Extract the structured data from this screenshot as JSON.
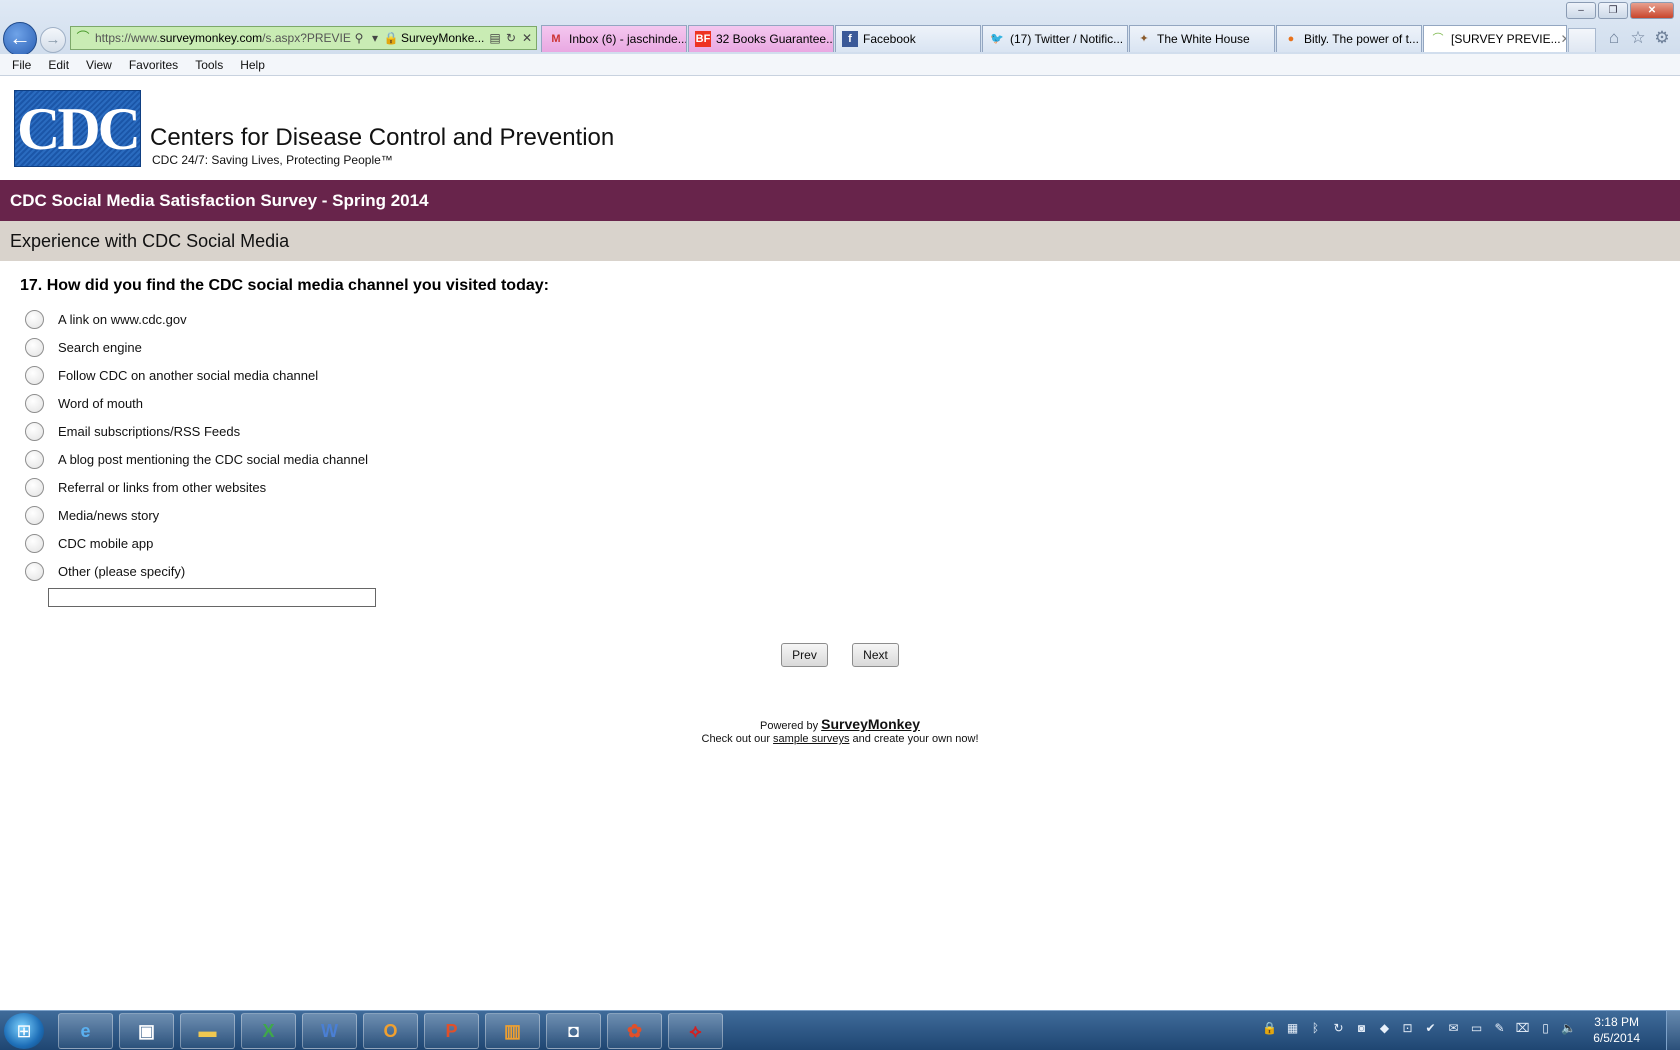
{
  "browser": {
    "address": {
      "url_prefix": "https://www.",
      "url_domain": "surveymonkey.com",
      "url_path": "/s.aspx?PREVIE",
      "site_label": "SurveyMonke..."
    },
    "tabs": [
      {
        "label": "Inbox (6) - jaschinde...",
        "icon": "gmail-icon"
      },
      {
        "label": "32 Books Guarantee...",
        "icon": "buzzfeed-icon"
      },
      {
        "label": "Facebook",
        "icon": "facebook-icon"
      },
      {
        "label": "(17) Twitter / Notific...",
        "icon": "twitter-icon"
      },
      {
        "label": "The White House",
        "icon": "whitehouse-icon"
      },
      {
        "label": "Bitly. The power of t...",
        "icon": "bitly-icon"
      },
      {
        "label": "[SURVEY PREVIE...",
        "icon": "surveymonkey-icon"
      }
    ],
    "menu": [
      "File",
      "Edit",
      "View",
      "Favorites",
      "Tools",
      "Help"
    ]
  },
  "header": {
    "logo_text": "CDC",
    "org_name": "Centers for Disease Control and Prevention",
    "tagline": "CDC 24/7: Saving Lives, Protecting People™"
  },
  "survey": {
    "title": "CDC Social Media Satisfaction Survey - Spring 2014",
    "section": "Experience with CDC Social Media",
    "question": "17. How did you find the CDC social media channel you visited today:",
    "options": [
      "A link on www.cdc.gov",
      "Search engine",
      "Follow CDC on another social media channel",
      "Word of mouth",
      "Email subscriptions/RSS Feeds",
      "A blog post mentioning the CDC social media channel",
      "Referral or links from other websites",
      "Media/news story",
      "CDC mobile app",
      "Other (please specify)"
    ],
    "other_value": "",
    "prev_label": "Prev",
    "next_label": "Next"
  },
  "footer": {
    "powered_prefix": "Powered by",
    "brand": "SurveyMonkey",
    "checkout_prefix": "Check out our",
    "checkout_link": "sample surveys",
    "checkout_suffix": "and create your own now!"
  },
  "taskbar": {
    "time": "3:18 PM",
    "date": "6/5/2014"
  }
}
